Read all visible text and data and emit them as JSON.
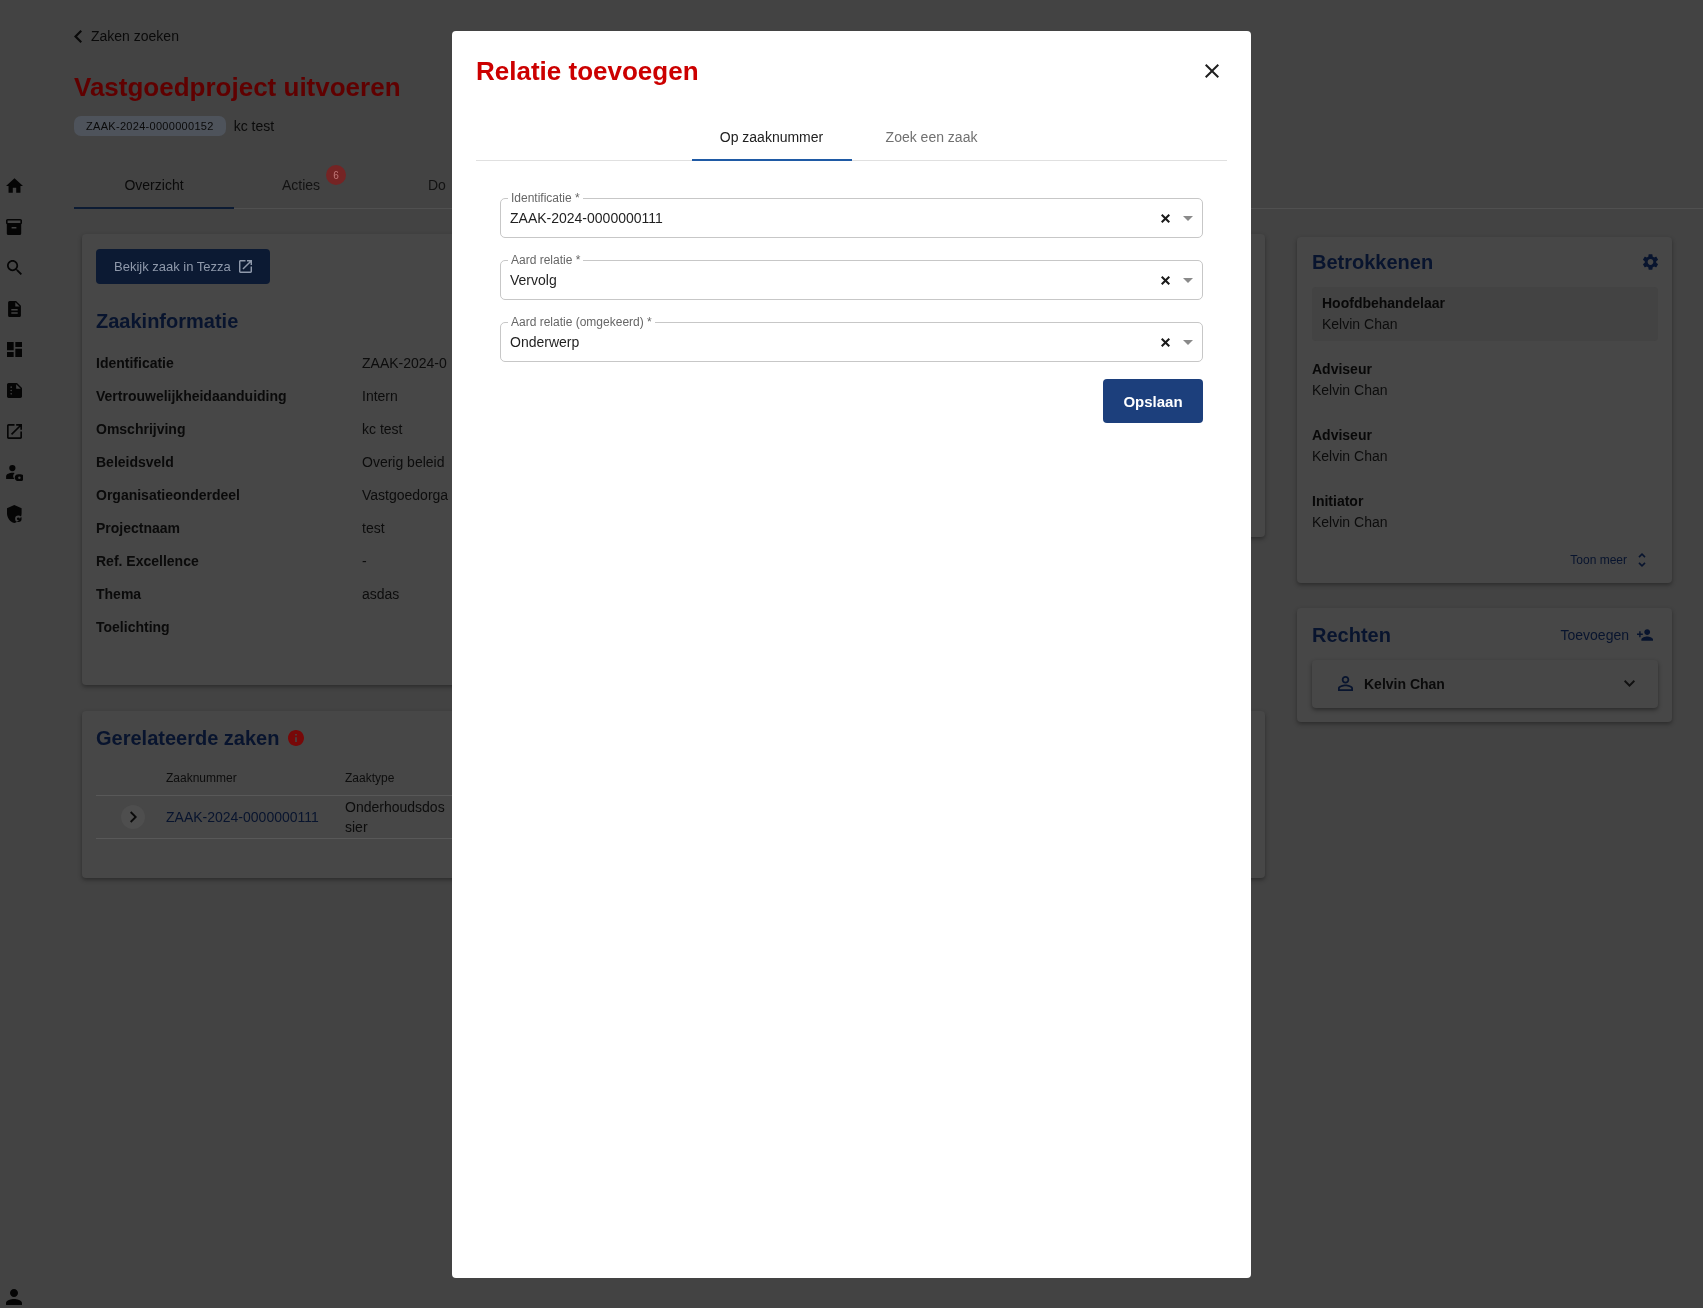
{
  "back_link": {
    "label": "Zaken zoeken"
  },
  "header": {
    "title": "Vastgoedproject uitvoeren",
    "case_number": "ZAAK-2024-0000000152",
    "description": "kc test"
  },
  "tabs": [
    {
      "label": "Overzicht",
      "selected": true
    },
    {
      "label": "Acties",
      "selected": false,
      "badge": "6"
    },
    {
      "label": "Do",
      "selected": false
    }
  ],
  "case_info": {
    "button": "Bekijk zaak in Tezza",
    "title": "Zaakinformatie",
    "rows": [
      {
        "label": "Identificatie",
        "value": "ZAAK-2024-0"
      },
      {
        "label": "Vertrouwelijkheidaanduiding",
        "value": "Intern"
      },
      {
        "label": "Omschrijving",
        "value": "kc test"
      },
      {
        "label": "Beleidsveld",
        "value": "Overig beleid"
      },
      {
        "label": "Organisatieonderdeel",
        "value": "Vastgoedorga"
      },
      {
        "label": "Projectnaam",
        "value": "test"
      },
      {
        "label": "Ref. Excellence",
        "value": "-"
      },
      {
        "label": "Thema",
        "value": "asdas"
      },
      {
        "label": "Toelichting"
      }
    ]
  },
  "related_cases": {
    "title": "Gerelateerde zaken",
    "columns": [
      "Zaaknummer",
      "Zaaktype"
    ],
    "rows": [
      {
        "case_number": "ZAAK-2024-0000000111",
        "case_type": "Onderhoudsdossier"
      }
    ]
  },
  "involved": {
    "title": "Betrokkenen",
    "entries": [
      {
        "role": "Hoofdbehandelaar",
        "name": "Kelvin Chan",
        "highlighted": true
      },
      {
        "role": "Adviseur",
        "name": "Kelvin Chan",
        "highlighted": false
      },
      {
        "role": "Adviseur",
        "name": "Kelvin Chan",
        "highlighted": false
      },
      {
        "role": "Initiator",
        "name": "Kelvin Chan",
        "highlighted": false
      }
    ],
    "show_more": "Toon meer"
  },
  "rights": {
    "title": "Rechten",
    "add_link": "Toevoegen",
    "entries": [
      {
        "name": "Kelvin Chan",
        "expanded": false
      }
    ]
  },
  "dialog": {
    "title": "Relatie toevoegen",
    "tabs": [
      {
        "label": "Op zaaknummer",
        "selected": true
      },
      {
        "label": "Zoek een zaak",
        "selected": false
      }
    ],
    "fields": [
      {
        "label": "Identificatie *",
        "value": "ZAAK-2024-0000000111"
      },
      {
        "label": "Aard relatie *",
        "value": "Vervolg"
      },
      {
        "label": "Aard relatie (omgekeerd) *",
        "value": "Onderwerp"
      }
    ],
    "submit": "Opslaan"
  }
}
